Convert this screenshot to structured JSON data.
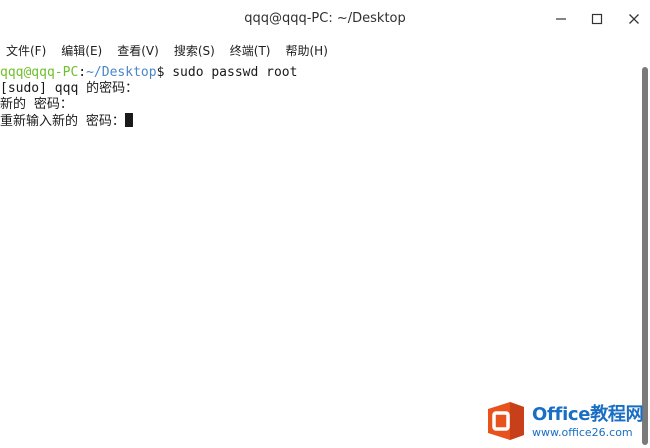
{
  "window": {
    "title": "qqq@qqq-PC: ~/Desktop"
  },
  "menu": {
    "items": [
      {
        "label": "文件(F)"
      },
      {
        "label": "编辑(E)"
      },
      {
        "label": "查看(V)"
      },
      {
        "label": "搜索(S)"
      },
      {
        "label": "终端(T)"
      },
      {
        "label": "帮助(H)"
      }
    ]
  },
  "terminal": {
    "prompt_user": "qqq@qqq-PC",
    "prompt_sep": ":",
    "prompt_path": "~/Desktop",
    "prompt_symbol": "$",
    "command": " sudo passwd root",
    "line2": "[sudo] qqq 的密码：",
    "line3": "新的 密码：",
    "line4": "重新输入新的 密码："
  },
  "watermark": {
    "brand": "Office教程网",
    "url": "www.office26.com"
  },
  "colors": {
    "prompt_user": "#6fbf2a",
    "prompt_path": "#4a86c8",
    "watermark_orange": "#e8521c",
    "watermark_blue": "#1a6fc4"
  }
}
